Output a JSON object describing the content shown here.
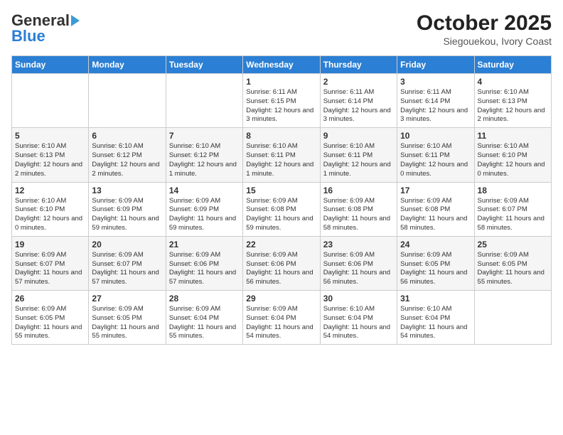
{
  "header": {
    "logo_general": "General",
    "logo_blue": "Blue",
    "title": "October 2025",
    "subtitle": "Siegouekou, Ivory Coast"
  },
  "weekdays": [
    "Sunday",
    "Monday",
    "Tuesday",
    "Wednesday",
    "Thursday",
    "Friday",
    "Saturday"
  ],
  "weeks": [
    [
      {
        "day": "",
        "info": ""
      },
      {
        "day": "",
        "info": ""
      },
      {
        "day": "",
        "info": ""
      },
      {
        "day": "1",
        "info": "Sunrise: 6:11 AM\nSunset: 6:15 PM\nDaylight: 12 hours and 3 minutes."
      },
      {
        "day": "2",
        "info": "Sunrise: 6:11 AM\nSunset: 6:14 PM\nDaylight: 12 hours and 3 minutes."
      },
      {
        "day": "3",
        "info": "Sunrise: 6:11 AM\nSunset: 6:14 PM\nDaylight: 12 hours and 3 minutes."
      },
      {
        "day": "4",
        "info": "Sunrise: 6:10 AM\nSunset: 6:13 PM\nDaylight: 12 hours and 2 minutes."
      }
    ],
    [
      {
        "day": "5",
        "info": "Sunrise: 6:10 AM\nSunset: 6:13 PM\nDaylight: 12 hours and 2 minutes."
      },
      {
        "day": "6",
        "info": "Sunrise: 6:10 AM\nSunset: 6:12 PM\nDaylight: 12 hours and 2 minutes."
      },
      {
        "day": "7",
        "info": "Sunrise: 6:10 AM\nSunset: 6:12 PM\nDaylight: 12 hours and 1 minute."
      },
      {
        "day": "8",
        "info": "Sunrise: 6:10 AM\nSunset: 6:11 PM\nDaylight: 12 hours and 1 minute."
      },
      {
        "day": "9",
        "info": "Sunrise: 6:10 AM\nSunset: 6:11 PM\nDaylight: 12 hours and 1 minute."
      },
      {
        "day": "10",
        "info": "Sunrise: 6:10 AM\nSunset: 6:11 PM\nDaylight: 12 hours and 0 minutes."
      },
      {
        "day": "11",
        "info": "Sunrise: 6:10 AM\nSunset: 6:10 PM\nDaylight: 12 hours and 0 minutes."
      }
    ],
    [
      {
        "day": "12",
        "info": "Sunrise: 6:10 AM\nSunset: 6:10 PM\nDaylight: 12 hours and 0 minutes."
      },
      {
        "day": "13",
        "info": "Sunrise: 6:09 AM\nSunset: 6:09 PM\nDaylight: 11 hours and 59 minutes."
      },
      {
        "day": "14",
        "info": "Sunrise: 6:09 AM\nSunset: 6:09 PM\nDaylight: 11 hours and 59 minutes."
      },
      {
        "day": "15",
        "info": "Sunrise: 6:09 AM\nSunset: 6:08 PM\nDaylight: 11 hours and 59 minutes."
      },
      {
        "day": "16",
        "info": "Sunrise: 6:09 AM\nSunset: 6:08 PM\nDaylight: 11 hours and 58 minutes."
      },
      {
        "day": "17",
        "info": "Sunrise: 6:09 AM\nSunset: 6:08 PM\nDaylight: 11 hours and 58 minutes."
      },
      {
        "day": "18",
        "info": "Sunrise: 6:09 AM\nSunset: 6:07 PM\nDaylight: 11 hours and 58 minutes."
      }
    ],
    [
      {
        "day": "19",
        "info": "Sunrise: 6:09 AM\nSunset: 6:07 PM\nDaylight: 11 hours and 57 minutes."
      },
      {
        "day": "20",
        "info": "Sunrise: 6:09 AM\nSunset: 6:07 PM\nDaylight: 11 hours and 57 minutes."
      },
      {
        "day": "21",
        "info": "Sunrise: 6:09 AM\nSunset: 6:06 PM\nDaylight: 11 hours and 57 minutes."
      },
      {
        "day": "22",
        "info": "Sunrise: 6:09 AM\nSunset: 6:06 PM\nDaylight: 11 hours and 56 minutes."
      },
      {
        "day": "23",
        "info": "Sunrise: 6:09 AM\nSunset: 6:06 PM\nDaylight: 11 hours and 56 minutes."
      },
      {
        "day": "24",
        "info": "Sunrise: 6:09 AM\nSunset: 6:05 PM\nDaylight: 11 hours and 56 minutes."
      },
      {
        "day": "25",
        "info": "Sunrise: 6:09 AM\nSunset: 6:05 PM\nDaylight: 11 hours and 55 minutes."
      }
    ],
    [
      {
        "day": "26",
        "info": "Sunrise: 6:09 AM\nSunset: 6:05 PM\nDaylight: 11 hours and 55 minutes."
      },
      {
        "day": "27",
        "info": "Sunrise: 6:09 AM\nSunset: 6:05 PM\nDaylight: 11 hours and 55 minutes."
      },
      {
        "day": "28",
        "info": "Sunrise: 6:09 AM\nSunset: 6:04 PM\nDaylight: 11 hours and 55 minutes."
      },
      {
        "day": "29",
        "info": "Sunrise: 6:09 AM\nSunset: 6:04 PM\nDaylight: 11 hours and 54 minutes."
      },
      {
        "day": "30",
        "info": "Sunrise: 6:10 AM\nSunset: 6:04 PM\nDaylight: 11 hours and 54 minutes."
      },
      {
        "day": "31",
        "info": "Sunrise: 6:10 AM\nSunset: 6:04 PM\nDaylight: 11 hours and 54 minutes."
      },
      {
        "day": "",
        "info": ""
      }
    ]
  ]
}
